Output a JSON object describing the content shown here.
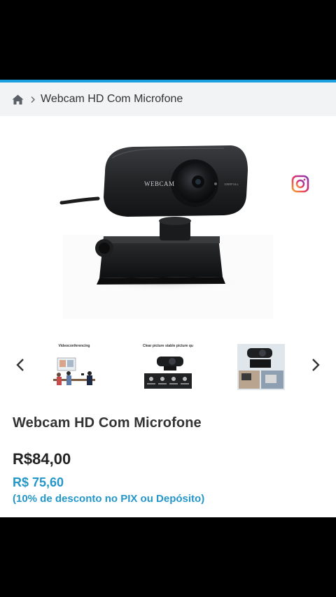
{
  "breadcrumb": {
    "home_icon": "home-icon",
    "separator_icon": "chevron-right-icon",
    "current": "Webcam HD Com Microfone"
  },
  "hero": {
    "device_brand": "WEBCAM",
    "instagram_icon": "instagram-icon"
  },
  "thumbnails": [
    {
      "caption": "Videoconferencing"
    },
    {
      "caption": "Clear picture stable picture quality"
    },
    {
      "caption": ""
    }
  ],
  "nav": {
    "prev_icon": "chevron-left-icon",
    "next_icon": "chevron-right-icon"
  },
  "product": {
    "title": "Webcam HD Com Microfone",
    "price": "R$84,00",
    "pix_price": "R$ 75,60",
    "pix_note": "(10% de desconto no PIX ou Depósito)"
  },
  "colors": {
    "accent": "#1a9fe0",
    "pix_blue": "#2497c9",
    "breadcrumb_bg": "#f1f3f4"
  }
}
